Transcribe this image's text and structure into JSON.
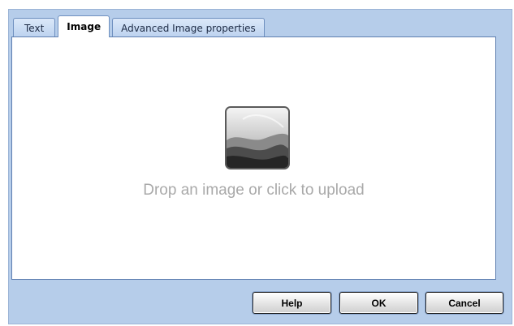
{
  "tabs": [
    {
      "label": "Text",
      "active": false
    },
    {
      "label": "Image",
      "active": true
    },
    {
      "label": "Advanced Image properties",
      "active": false
    }
  ],
  "drop_zone": {
    "icon": "image-placeholder-icon",
    "text": "Drop an image or click to upload"
  },
  "buttons": {
    "help": "Help",
    "ok": "OK",
    "cancel": "Cancel"
  },
  "colors": {
    "dialog_background": "#b6cdea",
    "panel_background": "#ffffff",
    "placeholder_text": "#a9a9a9"
  }
}
